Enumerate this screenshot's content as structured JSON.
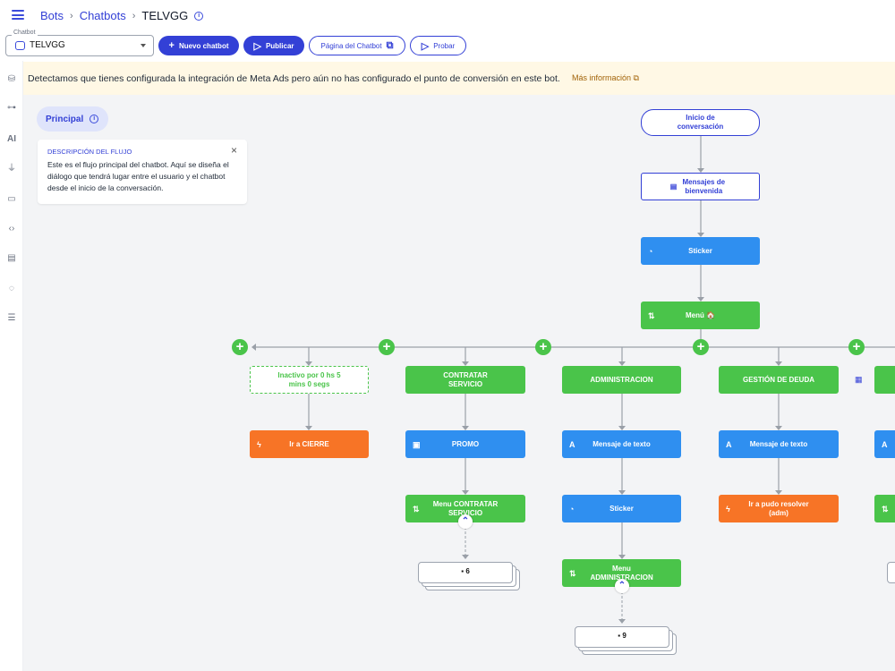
{
  "breadcrumb": {
    "item1": "Bots",
    "item2": "Chatbots",
    "current": "TELVGG"
  },
  "toolbar": {
    "select_label": "Chatbot",
    "select_value": "TELVGG",
    "new_chatbot": "Nuevo chatbot",
    "publish": "Publicar",
    "chatbot_page": "Página del Chatbot",
    "test": "Probar"
  },
  "banner": {
    "text": "Detectamos que tienes configurada la integración de Meta Ads pero aún no has configurado el punto de conversión en este bot.",
    "more": "Más información"
  },
  "sidebar": {
    "ai_label": "AI"
  },
  "flow": {
    "chip": "Principal",
    "description_title": "DESCRIPCIÓN DEL FLUJO",
    "description_body": "Este es el flujo principal del chatbot. Aquí se diseña el diálogo que tendrá lugar entre el usuario y el chatbot desde el inicio de la conversación."
  },
  "nodes": {
    "start": "Inicio de conversación",
    "welcome": "Mensajes de bienvenida",
    "sticker1": "Sticker",
    "menu": "Menú 🏠",
    "inactive": "Inactivo por 0 hs 5 mins 0 segs",
    "goto_cierre": "Ir a CIERRE",
    "contratar": "CONTRATAR SERVICIO",
    "promo": "PROMO",
    "menu_contratar": "Menu CONTRATAR SERVICIO",
    "stack1": "6",
    "administracion": "ADMINISTRACION",
    "msg_text1": "Mensaje de texto",
    "sticker2": "Sticker",
    "menu_admin": "Menu ADMINISTRACION",
    "stack2": "9",
    "gestion": "GESTIÓN DE DEUDA",
    "msg_text2": "Mensaje de texto",
    "goto_pudo": "Ir a pudo resolver (adm)"
  },
  "colors": {
    "accent": "#3340d6",
    "blue_node": "#2f8ff0",
    "green_node": "#4ac44a",
    "orange_node": "#f77426",
    "banner_bg": "#fff8e5",
    "canvas_bg": "#f3f4f6"
  }
}
